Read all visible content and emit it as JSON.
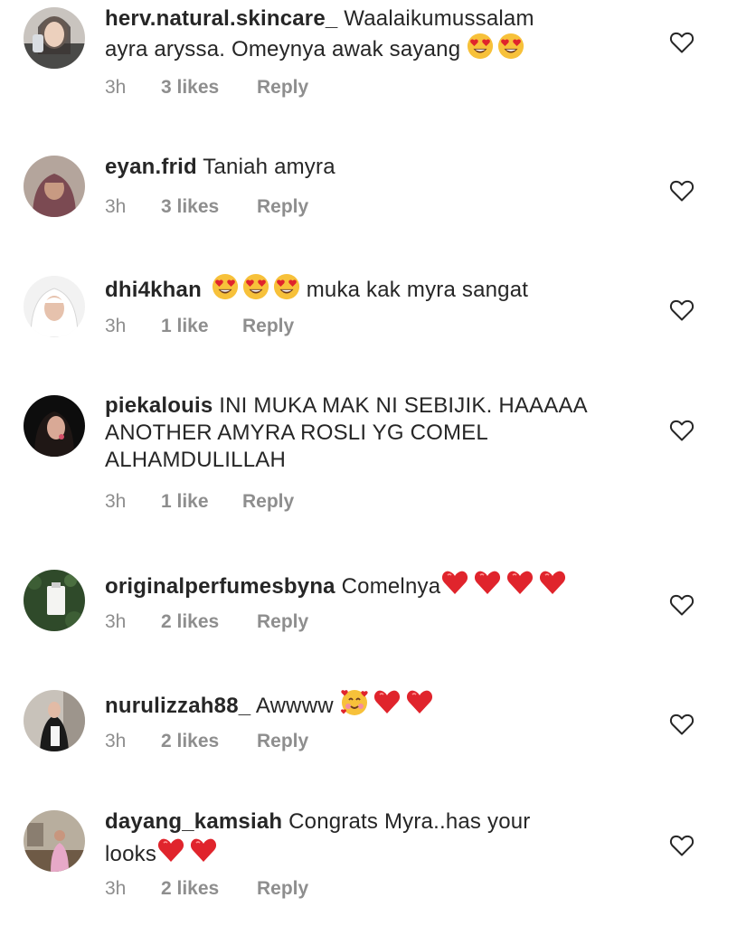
{
  "comments": [
    {
      "username": "herv.natural.skincare_",
      "line1": "Waalaikumussalam",
      "line2": "ayra aryssa. Omeynya awak sayang",
      "emoji": [
        "heart-eyes",
        "heart-eyes"
      ],
      "time": "3h",
      "likes": "3 likes",
      "reply": "Reply"
    },
    {
      "username": "eyan.frid",
      "text": "Taniah amyra",
      "time": "3h",
      "likes": "3 likes",
      "reply": "Reply"
    },
    {
      "username": "dhi4khan",
      "emoji": [
        "heart-eyes",
        "heart-eyes",
        "heart-eyes"
      ],
      "text": "muka kak myra sangat",
      "time": "3h",
      "likes": "1 like",
      "reply": "Reply"
    },
    {
      "username": "piekalouis",
      "line1": "INI MUKA MAK NI SEBIJIK. HAAAAA",
      "line2": "ANOTHER AMYRA ROSLI YG COMEL",
      "line3": "ALHAMDULILLAH",
      "time": "3h",
      "likes": "1 like",
      "reply": "Reply"
    },
    {
      "username": "originalperfumesbyna",
      "text": "Comelnya",
      "emoji": [
        "red-heart",
        "red-heart",
        "red-heart",
        "red-heart"
      ],
      "time": "3h",
      "likes": "2 likes",
      "reply": "Reply"
    },
    {
      "username": "nurulizzah88_",
      "text": "Awwww",
      "emoji": [
        "smiling-face-with-hearts",
        "red-heart",
        "red-heart"
      ],
      "time": "3h",
      "likes": "2 likes",
      "reply": "Reply"
    },
    {
      "username": "dayang_kamsiah",
      "line1": "Congrats Myra..has your",
      "line2": "looks",
      "emoji": [
        "red-heart",
        "red-heart"
      ],
      "time": "3h",
      "likes": "2 likes",
      "reply": "Reply"
    }
  ],
  "colors": {
    "text": "#262626",
    "meta": "#8e8e8e",
    "heart_red": "#e0242c",
    "emoji_yellow": "#f7c13a"
  }
}
